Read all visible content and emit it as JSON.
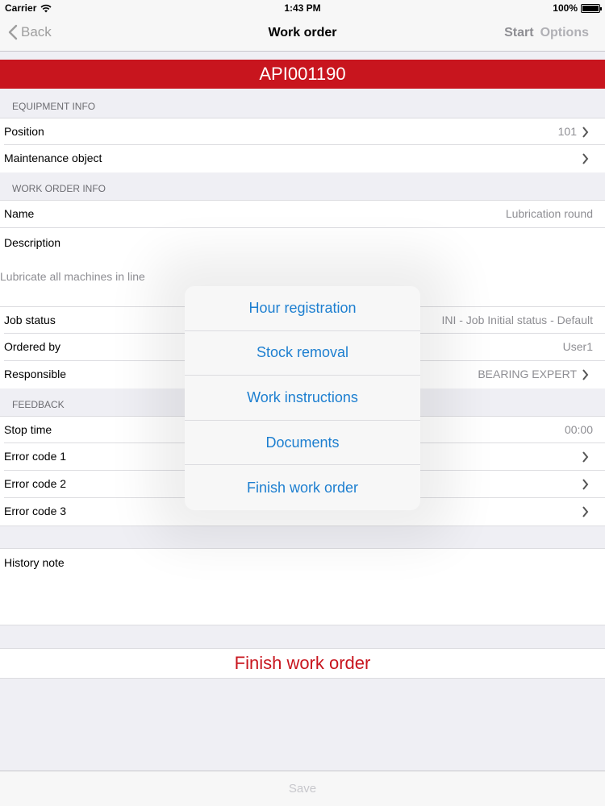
{
  "status_bar": {
    "carrier": "Carrier",
    "time": "1:43 PM",
    "battery": "100%"
  },
  "nav": {
    "back_label": "Back",
    "title": "Work order",
    "start_label": "Start",
    "options_label": "Options"
  },
  "banner": {
    "text": "API001190"
  },
  "sections": {
    "equipment": "EQUIPMENT INFO",
    "work_order": "WORK ORDER INFO",
    "feedback": "FEEDBACK"
  },
  "equipment": {
    "position_label": "Position",
    "position_value": "101",
    "maintenance_label": "Maintenance object"
  },
  "work_order": {
    "name_label": "Name",
    "name_value": "Lubrication round",
    "description_label": "Description",
    "description_value": "Lubricate all machines in line",
    "job_status_label": "Job status",
    "job_status_value": "INI - Job Initial status - Default",
    "ordered_by_label": "Ordered by",
    "ordered_by_value": "User1",
    "responsible_label": "Responsible",
    "responsible_value": "BEARING EXPERT"
  },
  "feedback": {
    "stop_time_label": "Stop time",
    "stop_time_value": "00:00",
    "error1_label": "Error code 1",
    "error2_label": "Error code 2",
    "error3_label": "Error code 3"
  },
  "history": {
    "label": "History note"
  },
  "finish_button": "Finish work order",
  "toolbar": {
    "save_label": "Save"
  },
  "popover": {
    "items": [
      "Hour registration",
      "Stock removal",
      "Work instructions",
      "Documents",
      "Finish work order"
    ]
  },
  "colors": {
    "accent_red": "#c8151e",
    "link_blue": "#1d7fd0"
  }
}
